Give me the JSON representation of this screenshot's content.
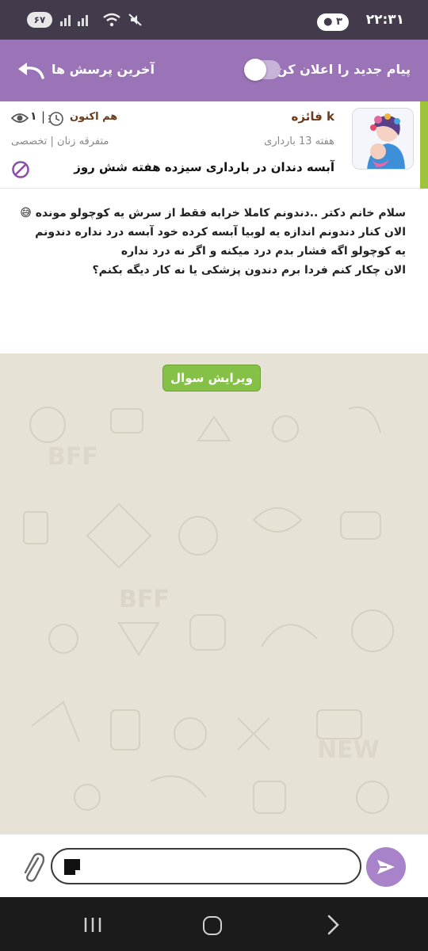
{
  "status_bar": {
    "time": "۲۲:۳۱",
    "notification_count": "۳",
    "battery": "۶۷"
  },
  "header": {
    "notify_label": "پیام جدید را اعلان کن",
    "notify_toggle_on": false,
    "recent_questions_label": "آخرین پرسش ها"
  },
  "question": {
    "author": "فائزه k",
    "time": "هم اکنون",
    "views": "۱",
    "week": "هفته 13 بارداری",
    "category": "متفرقه زنان | تخصصی",
    "title": "آبسه دندان در بارداری سیزده هفته شش روز",
    "body_lines": [
      "سلام خانم دکتر ..دندونم کاملا خرابه فقط از سرش یه کوچولو مونده 😅",
      "الان کنار دندونم اندازه یه لوبیا آبسه کرده خود آبسه درد نداره دندونم",
      "یه کوچولو اگه فشار بدم درد میکنه و اگر نه درد نداره",
      "الان چکار کنم فردا برم دندون پزشکی یا نه کار دیگه بکنم؟"
    ]
  },
  "edit_button_label": "ویرایش سوال",
  "input": {
    "value": "",
    "placeholder": ""
  },
  "colors": {
    "header_bg": "#9b74b8",
    "status_bg": "#433a4b",
    "accent_green": "#9dc43b",
    "edit_button": "#86c147",
    "send_button": "#a983c9"
  },
  "icons": [
    "back-arrow-icon",
    "clock-icon",
    "eye-icon",
    "block-icon",
    "attach-icon",
    "send-icon",
    "chat-bubble-icon",
    "wifi-icon",
    "signal-icon",
    "mute-icon"
  ]
}
